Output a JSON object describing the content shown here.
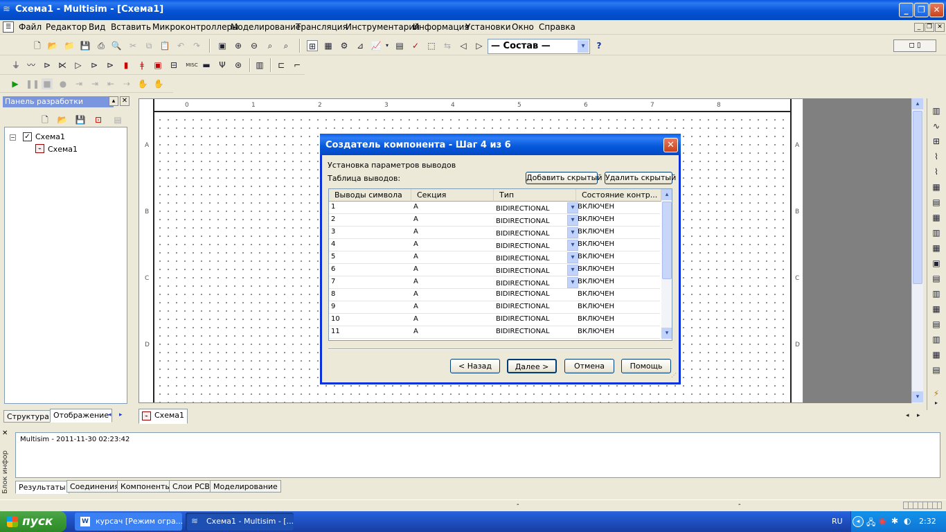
{
  "window": {
    "title": "Схема1 - Multisim - [Схема1]",
    "min": "_",
    "max": "❐",
    "close": "✕"
  },
  "menu": [
    "Файл",
    "Редактор",
    "Вид",
    "Вставить",
    "Микроконтроллеры",
    "Моделирование",
    "Трансляция",
    "Инструментарий",
    "Информация",
    "Установки",
    "Окно",
    "Справка"
  ],
  "toolbar": {
    "combo_value": "— Состав —",
    "help_glyph": "?"
  },
  "design_panel": {
    "title": "Панель разработки",
    "tree_root": "Схема1",
    "tree_child": "Схема1",
    "tabs": [
      "Структура",
      "Отображение"
    ]
  },
  "canvas": {
    "ruler_numbers": [
      "0",
      "1",
      "2",
      "3",
      "4",
      "5",
      "6",
      "7",
      "8"
    ],
    "row_letters": [
      "A",
      "B",
      "C",
      "D"
    ],
    "sheet_tab": "Схема1"
  },
  "dialog": {
    "title": "Создатель компонента - Шаг 4 из 6",
    "section_label": "Установка параметров выводов",
    "table_label": "Таблица выводов:",
    "add_hidden": "Добавить скрытый",
    "remove_hidden": "Удалить скрытый",
    "columns": [
      "Выводы символа",
      "Секция",
      "Тип",
      "Состояние контр..."
    ],
    "rows": [
      {
        "pin": "1",
        "section": "A",
        "type": "BIDIRECTIONAL",
        "state": "ВКЛЮЧЕН"
      },
      {
        "pin": "2",
        "section": "A",
        "type": "BIDIRECTIONAL",
        "state": "ВКЛЮЧЕН"
      },
      {
        "pin": "3",
        "section": "A",
        "type": "BIDIRECTIONAL",
        "state": "ВКЛЮЧЕН"
      },
      {
        "pin": "4",
        "section": "A",
        "type": "BIDIRECTIONAL",
        "state": "ВКЛЮЧЕН"
      },
      {
        "pin": "5",
        "section": "A",
        "type": "BIDIRECTIONAL",
        "state": "ВКЛЮЧЕН"
      },
      {
        "pin": "6",
        "section": "A",
        "type": "BIDIRECTIONAL",
        "state": "ВКЛЮЧЕН"
      },
      {
        "pin": "7",
        "section": "A",
        "type": "BIDIRECTIONAL",
        "state": "ВКЛЮЧЕН"
      },
      {
        "pin": "8",
        "section": "A",
        "type": "BIDIRECTIONAL",
        "state": "ВКЛЮЧЕН"
      },
      {
        "pin": "9",
        "section": "A",
        "type": "BIDIRECTIONAL",
        "state": "ВКЛЮЧЕН"
      },
      {
        "pin": "10",
        "section": "A",
        "type": "BIDIRECTIONAL",
        "state": "ВКЛЮЧЕН"
      },
      {
        "pin": "11",
        "section": "A",
        "type": "BIDIRECTIONAL",
        "state": "ВКЛЮЧЕН"
      }
    ],
    "buttons": {
      "back": "< Назад",
      "next": "Далее >",
      "cancel": "Отмена",
      "help": "Помощь"
    }
  },
  "output": {
    "log": "Multisim  -  2011-11-30 02:23:42",
    "side_label": "Блок инфор",
    "tabs": [
      "Результаты",
      "Соединения",
      "Компоненты",
      "Слои PCB",
      "Моделирование"
    ]
  },
  "statusbar": {
    "cell1": "-",
    "cell2": "-"
  },
  "taskbar": {
    "start": "пуск",
    "tasks": [
      "курсач [Режим огра...",
      "Схема1 - Multisim - [..."
    ],
    "lang": "RU",
    "clock": "2:32"
  },
  "colors": {
    "xp_blue": "#0a58e0",
    "dialog_border": "#0831d9",
    "start_green": "#3c9b36",
    "canvas_grey": "#808080"
  }
}
